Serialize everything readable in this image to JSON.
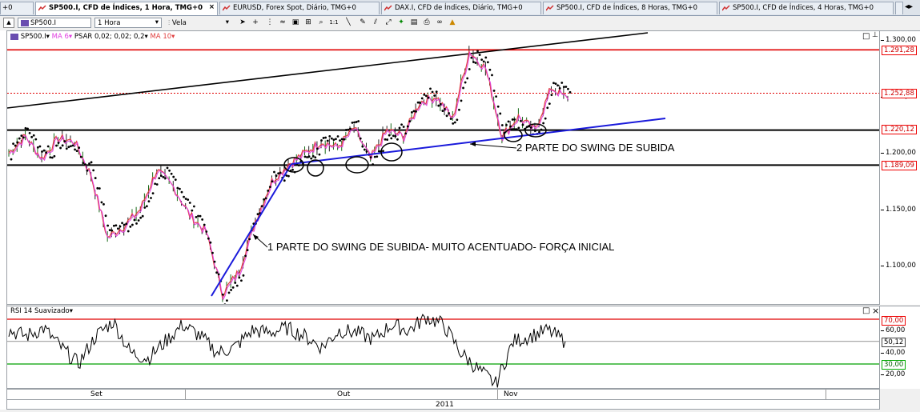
{
  "tabs": [
    {
      "label": "+0"
    },
    {
      "label": "SP500.I, CFD de Índices, 1 Hora, TMG+0",
      "active": true
    },
    {
      "label": "EURUSD, Forex Spot, Diário, TMG+0"
    },
    {
      "label": "DAX.I, CFD de Índices, Diário, TMG+0"
    },
    {
      "label": "SP500.I, CFD de Índices, 8 Horas, TMG+0"
    },
    {
      "label": "SP500.I, CFD de Índices, 4 Horas, TMG+0"
    }
  ],
  "toolbar": {
    "symbol": "SP500.I",
    "timeframe": "1 Hora",
    "chart_type": "Vela"
  },
  "indicators": {
    "symbol_label": "SP500.I",
    "ma6": "MA 6",
    "psar": "PSAR 0,02; 0,02; 0,2",
    "ma10": "MA 10"
  },
  "rsi_label": "RSI 14 Suavizado",
  "colors": {
    "resistance": "#e00000",
    "support": "#000000",
    "trend": "#1a1adb",
    "rsi_high": "#e00000",
    "rsi_low": "#00a000",
    "ma6": "#e040e0",
    "ma10": "#e04040"
  },
  "annotations": {
    "swing1": "1 PARTE DO SWING DE SUBIDA- MUITO ACENTUADO- FORÇA INICIAL",
    "swing2": "2 PARTE DO SWING DE SUBIDA"
  },
  "price_axis": {
    "ticks": [
      "1.300,00",
      "1.250,00",
      "1.200,00",
      "1.150,00",
      "1.100,00"
    ],
    "levels": {
      "resistance": "1.291,28",
      "current": "1.252,88",
      "mid_support": "1.220,12",
      "low_support": "1.189,09"
    }
  },
  "rsi_axis": {
    "ticks": [
      "60,00",
      "40,00",
      "20,00"
    ],
    "levels": {
      "high": "70,00",
      "current": "50,12",
      "low": "30,00"
    }
  },
  "time_axis": {
    "months": [
      "Set",
      "Out",
      "Nov"
    ],
    "year": "2011"
  },
  "chart_data": {
    "type": "line",
    "title": "SP500.I, CFD de Índices, 1 Hora",
    "xlabel": "",
    "ylabel": "",
    "x": [
      "Set",
      "Out",
      "Nov"
    ],
    "ylim": [
      1060,
      1305
    ],
    "series": [
      {
        "name": "SP500.I",
        "y": [
          1200,
          1215,
          1195,
          1213,
          1210,
          1180,
          1125,
          1135,
          1150,
          1185,
          1170,
          1145,
          1130,
          1075,
          1095,
          1140,
          1175,
          1190,
          1200,
          1210,
          1205,
          1222,
          1195,
          1220,
          1215,
          1245,
          1250,
          1230,
          1290,
          1275,
          1215,
          1232,
          1220,
          1258,
          1248
        ]
      }
    ],
    "horizontal_levels": [
      1291.28,
      1252.88,
      1220.12,
      1189.09
    ],
    "rsi": {
      "name": "RSI 14 Suavizado",
      "levels": [
        70,
        30
      ],
      "current": 50.12,
      "values": [
        60,
        55,
        62,
        45,
        30,
        55,
        68,
        40,
        35,
        50,
        65,
        55,
        40,
        45,
        60,
        58,
        62,
        55,
        45,
        60,
        58,
        52,
        65,
        60,
        72,
        65,
        40,
        25,
        12,
        50,
        55,
        60,
        50
      ]
    }
  }
}
